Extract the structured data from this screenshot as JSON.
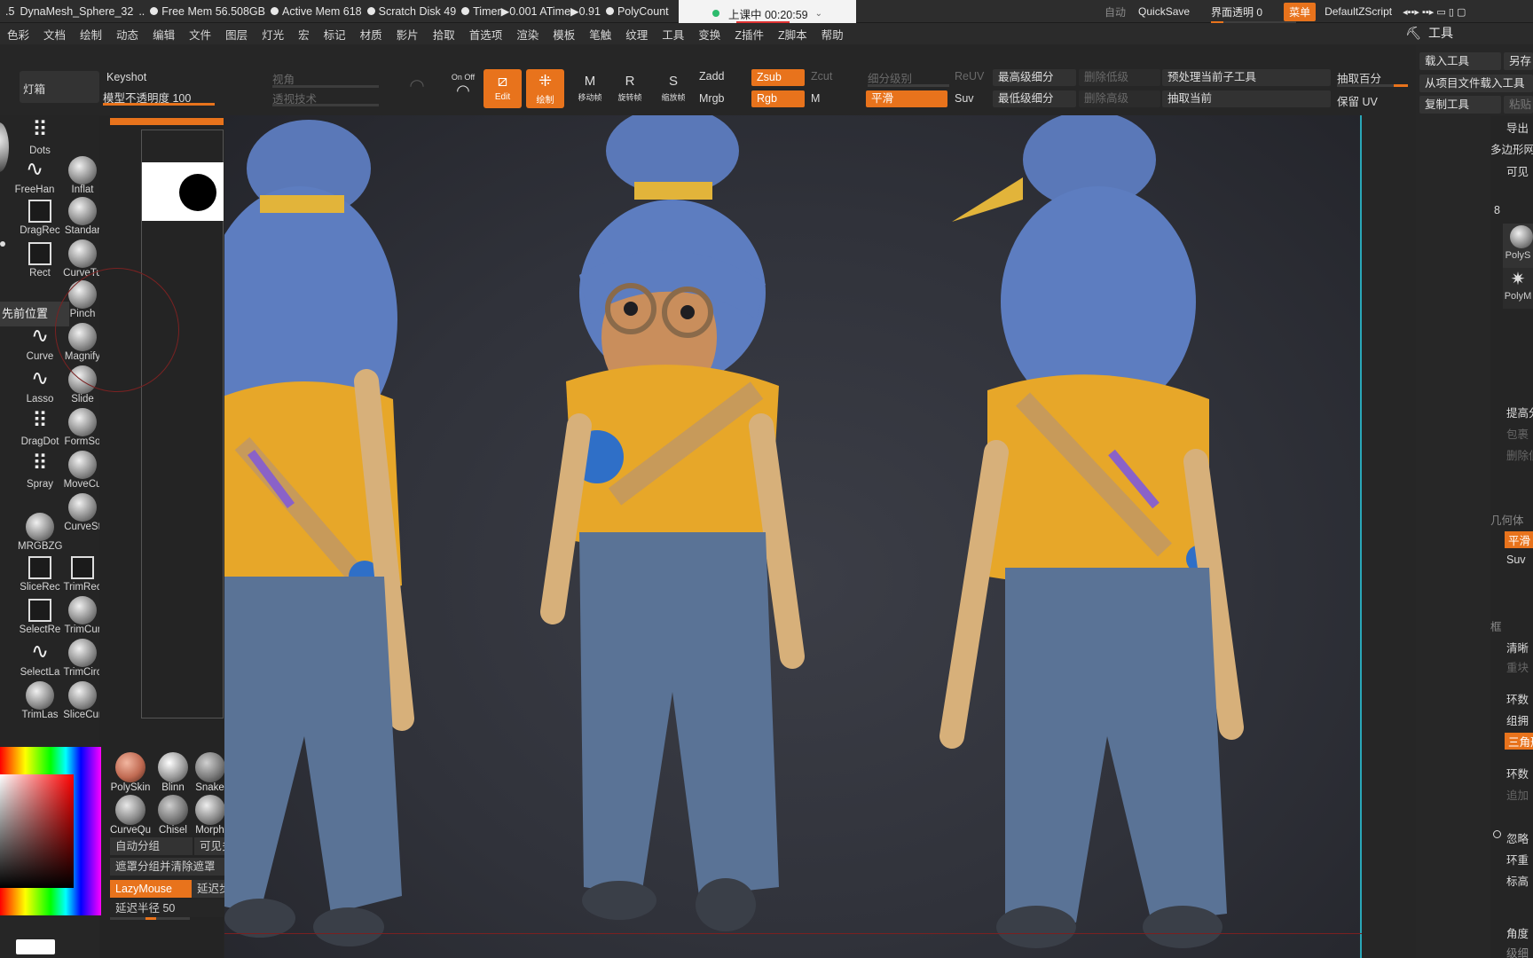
{
  "titlebar": {
    "lead": ".5",
    "title": "DynaMesh_Sphere_32",
    "dots": "..",
    "free_mem": "Free Mem 56.508GB",
    "active_mem": "Active Mem 618",
    "scratch": "Scratch Disk 49",
    "timer": "Timer▶0.001 ATime▶0.91",
    "polycount": "PolyCount",
    "auto": "自动",
    "quicksave": "QuickSave",
    "ui_opacity": "界面透明 0",
    "menu_btn": "菜单",
    "script": "DefaultZScript",
    "window_ctrls": "◂▪▪▸ ▪▪▸ ▭ ▯ ▢"
  },
  "recording": {
    "label": "上课中 00:20:59",
    "chevron": "⌄"
  },
  "menus": [
    "色彩",
    "文档",
    "绘制",
    "动态",
    "编辑",
    "文件",
    "图层",
    "灯光",
    "宏",
    "标记",
    "材质",
    "影片",
    "拾取",
    "首选项",
    "渲染",
    "模板",
    "笔触",
    "纹理",
    "工具",
    "变换",
    "Z插件",
    "Z脚本",
    "帮助"
  ],
  "tool_panel_title": "工具",
  "shelf": {
    "lightbox": "灯箱",
    "keyshot": "Keyshot",
    "opacity": "模型不透明度 100",
    "opacity_value": 100,
    "persp": "视角",
    "persp2": "透视技术",
    "onoff": "On Off",
    "edit": "Edit",
    "draw": "绘制",
    "move": "移动帧",
    "scale": "旋转帧",
    "rotate": "缩放帧",
    "zadd": "Zadd",
    "zsub": "Zsub",
    "zcut": "Zcut",
    "mrgb": "Mrgb",
    "rgb": "Rgb",
    "m": "M",
    "subdiv": "细分级别",
    "smooth": "平滑",
    "reuv": "ReUV",
    "suv": "Suv",
    "highest": "最高级细分",
    "lowest": "最低级细分",
    "del_lower": "删除低级",
    "del_higher": "删除高级",
    "proj_sub": "预处理当前子工具",
    "extract_cur": "抽取当前",
    "extract_pct": "抽取百分",
    "keep_uv": "保留 UV"
  },
  "brushes": [
    {
      "name": "Dots"
    },
    {
      "name": "FreeHan"
    },
    {
      "name": "Inflat"
    },
    {
      "name": "DragRec"
    },
    {
      "name": "Standar"
    },
    {
      "name": "Rect"
    },
    {
      "name": "CurveTu"
    },
    {
      "name": "Pinch"
    },
    {
      "name": "Curve"
    },
    {
      "name": "Magnify"
    },
    {
      "name": "Lasso"
    },
    {
      "name": "Slide"
    },
    {
      "name": "DragDot"
    },
    {
      "name": "FormSo"
    },
    {
      "name": "Spray"
    },
    {
      "name": "MoveCu"
    },
    {
      "name": "CurveSt"
    },
    {
      "name": "MRGBZG"
    },
    {
      "name": "SliceRec"
    },
    {
      "name": "TrimRec"
    },
    {
      "name": "SelectRe"
    },
    {
      "name": "TrimCur"
    },
    {
      "name": "SelectLa"
    },
    {
      "name": "TrimCirc"
    },
    {
      "name": "TrimLas"
    },
    {
      "name": "SliceCur"
    }
  ],
  "prev_position": "先前位置",
  "materials": [
    {
      "name": "PolySkin"
    },
    {
      "name": "Blinn"
    },
    {
      "name": "Snake"
    },
    {
      "name": "CurveQu"
    },
    {
      "name": "Chisel"
    },
    {
      "name": "Morph"
    }
  ],
  "subcol": {
    "auto_group": "自动分组",
    "visible": "可见多",
    "mask_group": "遮罩分组并清除遮罩",
    "lazymouse": "LazyMouse",
    "lazy_step": "延迟步",
    "lazy_radius": "延迟半径 50"
  },
  "right_panel": {
    "load_tool": "载入工具",
    "save_as": "另存",
    "load_from_project": "从项目文件载入工具",
    "copy_tool": "复制工具",
    "paste": "粘贴",
    "export": "导出",
    "polymesh": "多边形网",
    "visible": "可见",
    "num": "8",
    "polysphere": "PolyS",
    "polymesh_star": "PolyM",
    "raise": "提高分",
    "envelope": "包裹",
    "delete_lower": "删除低",
    "geometry": "几何体",
    "smooth": "平滑",
    "suv": "Suv",
    "frame": "框",
    "clear": "清晰",
    "duplicate": "重块",
    "loops": "环数",
    "group_loops": "组拥",
    "triangle": "三角形",
    "loops2": "环数",
    "append": "追加",
    "ignore": "忽略",
    "ring_weight": "环重",
    "mark": "标高",
    "angle": "角度",
    "last": "级细"
  },
  "colors": {
    "accent": "#e8731c",
    "viewport_line": "#2aa7b8",
    "rec_green": "#2dbb6d"
  }
}
